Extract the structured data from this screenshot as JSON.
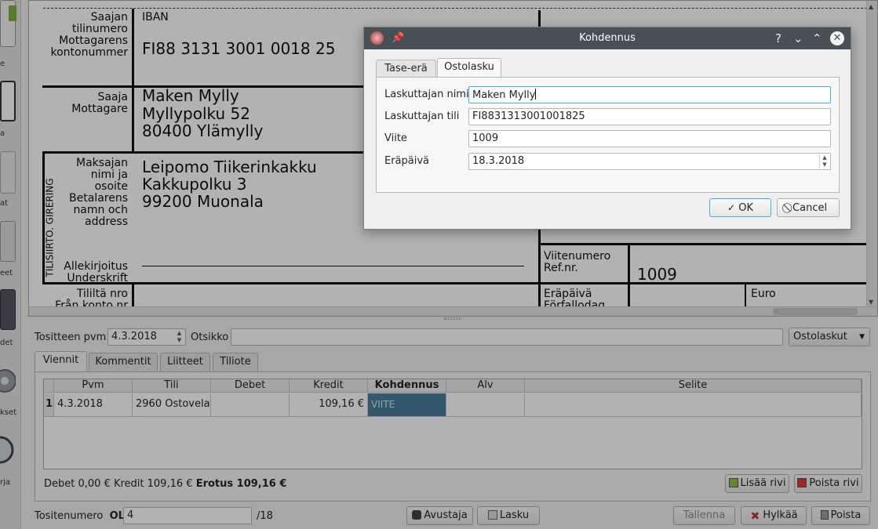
{
  "left_toolbar": {
    "items": [
      {
        "label": "e"
      },
      {
        "label": "a"
      },
      {
        "label": "at"
      },
      {
        "label": "eet"
      },
      {
        "label": "det"
      },
      {
        "label": "kset"
      },
      {
        "label": "rja"
      }
    ]
  },
  "giro": {
    "recipient_account_label": "Saajan\ntilinumero\nMottagarens\nkontonummer",
    "iban_label": "IBAN",
    "iban_value": "FI88 3131 3001 0018 25",
    "recipient_label": "Saaja\nMottagare",
    "recipient_name": "Maken Mylly",
    "recipient_street": "Myllypolku 52",
    "recipient_city": "80400 Ylämylly",
    "payer_label": "Maksajan\nnimi ja\nosoite\nBetalarens\nnamn och\naddress",
    "payer_name": "Leipomo Tiikerinkakku",
    "payer_street": "Kakkupolku 3",
    "payer_city": "99200 Muonala",
    "side_label": "TILISIIRTO. GIRERING",
    "signature_label": "Allekirjoitus\nUnderskrift",
    "reference_label": "Viitenumero\nRef.nr.",
    "reference_value": "1009",
    "from_account_label": "Tililtä nro\nFrån konto nr",
    "due_label": "Eräpäivä\nFörfallodag",
    "euro_label": "Euro"
  },
  "form": {
    "date_label": "Tositteen pvm",
    "date_value": "4.3.2018",
    "title_label": "Otsikko",
    "title_value": "",
    "type_value": "Ostolaskut",
    "tabs": [
      {
        "label": "Viennit"
      },
      {
        "label": "Kommentit"
      },
      {
        "label": "Liitteet"
      },
      {
        "label": "Tiliote"
      }
    ],
    "columns": [
      "Pvm",
      "Tili",
      "Debet",
      "Kredit",
      "Kohdennus",
      "Alv",
      "Selite"
    ],
    "rows": [
      {
        "num": "1",
        "pvm": "4.3.2018",
        "tili": "2960 Ostovelat",
        "debet": "",
        "kredit": "109,16 €",
        "kohdennus": "VIITE",
        "alv": "",
        "selite": ""
      }
    ],
    "summary_plain": "Debet 0,00 € Kredit 109,16 €",
    "summary_bold": "Erotus 109,16 €",
    "add_row": "Lisää rivi",
    "remove_row": "Poista rivi",
    "voucher_label": "Tositenumero",
    "voucher_series": "OL",
    "voucher_value": "4",
    "voucher_total": "/18",
    "assistant_button": "Avustaja",
    "invoice_button": "Lasku",
    "save_button": "Tallenna",
    "discard_button": "Hylkää",
    "delete_button": "Poista"
  },
  "dialog": {
    "title": "Kohdennus",
    "tabs": [
      {
        "label": "Tase-erä"
      },
      {
        "label": "Ostolasku"
      }
    ],
    "fields": {
      "biller_name_label": "Laskuttajan nimi",
      "biller_name_value": "Maken Mylly",
      "biller_account_label": "Laskuttajan tili",
      "biller_account_value": "FI8831313001001825",
      "reference_label": "Viite",
      "reference_value": "1009",
      "due_label": "Eräpäivä",
      "due_value": "18.3.2018"
    },
    "ok_button": "OK",
    "cancel_button": "Cancel",
    "titlebar_help": "?"
  },
  "colors": {
    "selected_cell": "#4a7f9c",
    "dialog_titlebar": "#475057"
  }
}
